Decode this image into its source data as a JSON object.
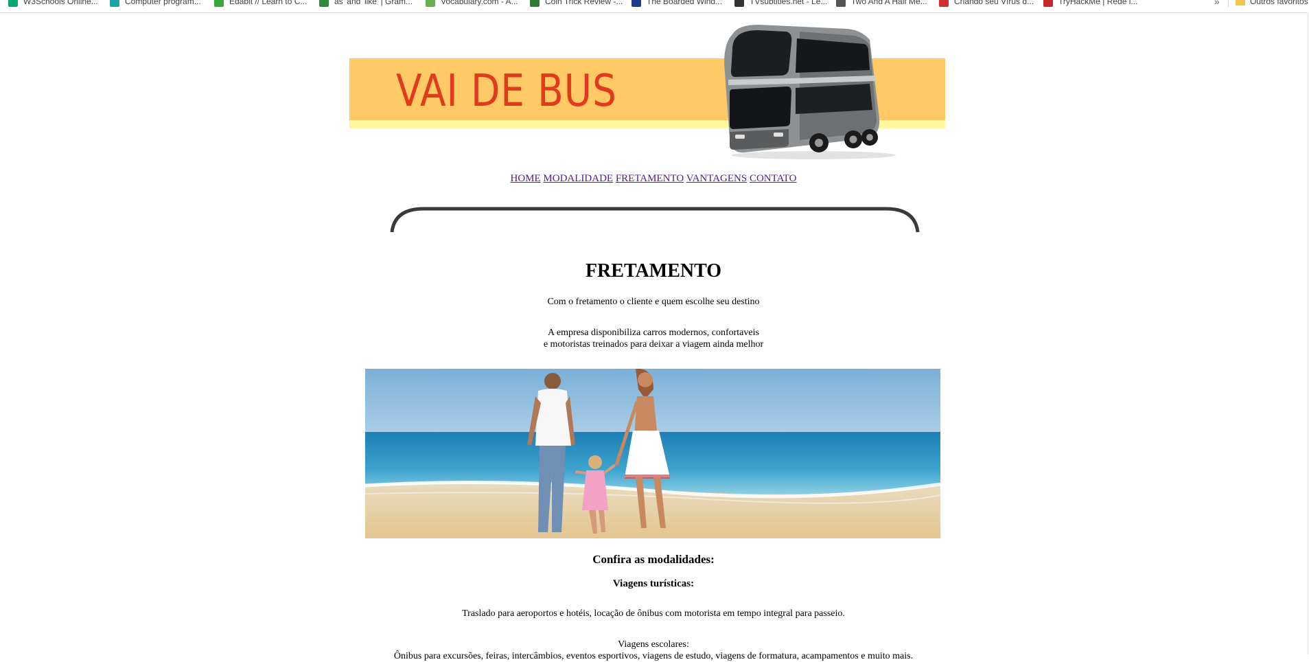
{
  "bookmarks": {
    "items": [
      {
        "label": "W3Schools Online...",
        "icon": "w3schools-icon",
        "color": "#04aa6d"
      },
      {
        "label": "Computer program...",
        "icon": "hexagon-icon",
        "color": "#1aa3a3"
      },
      {
        "label": "Edabit // Learn to C...",
        "icon": "edabit-icon",
        "color": "#3aa83a"
      },
      {
        "label": "as' and 'like' | Gram...",
        "icon": "grammar-icon",
        "color": "#2d8a3b"
      },
      {
        "label": "Vocabulary.com - A...",
        "icon": "vocabulary-icon",
        "color": "#6ab04c"
      },
      {
        "label": "Coin Trick Review -...",
        "icon": "coin-icon",
        "color": "#2e7d32"
      },
      {
        "label": "The Boarded Wind...",
        "icon": "chart-bars-icon",
        "color": "#1e3a8a"
      },
      {
        "label": "TVsubtitles.net - Le...",
        "icon": "film-icon",
        "color": "#333333"
      },
      {
        "label": "Two And A Half Me...",
        "icon": "tv-icon",
        "color": "#555555"
      },
      {
        "label": "Criando seu Vírus d...",
        "icon": "virus-icon",
        "color": "#d32f2f"
      },
      {
        "label": "TryHackMe | Rede i...",
        "icon": "hacker-icon",
        "color": "#c62828"
      }
    ],
    "more": "»",
    "others": "Outros favoritos"
  },
  "banner": {
    "title": "VAI DE BUS",
    "band_color": "#ffca66",
    "title_color": "#e23a1c"
  },
  "nav": {
    "home": "HOME",
    "modalidade": "MODALIDADE",
    "fretamento": "FRETAMENTO",
    "vantagens": "VANTAGENS",
    "contato": "CONTATO"
  },
  "main": {
    "title": "FRETAMENTO",
    "intro": "Com o fretamento o cliente e quem escolhe seu destino",
    "desc_line1": "A empresa disponibiliza carros modernos, confortaveis",
    "desc_line2": "e motoristas treinados para deixar a viagem ainda melhor",
    "modalidades_heading": "Confira as modalidades:",
    "turisticas_heading": "Viagens turísticas:",
    "turisticas_text": "Traslado para aeroportos e hotéis, locação de ônibus com motorista em tempo integral para passeio.",
    "escolares_heading": "Viagens escolares:",
    "escolares_text": "Ônibus para excursões, feiras, intercâmbios, eventos esportivos, viagens de estudo, viagens de formatura, acampamentos e muito mais."
  }
}
